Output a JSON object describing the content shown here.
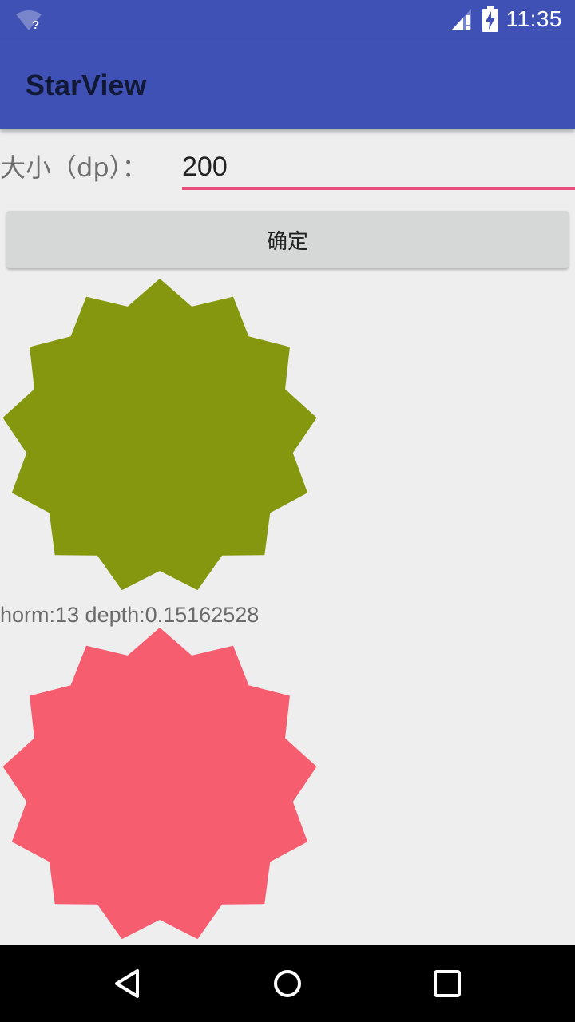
{
  "status_bar": {
    "time": "11:35",
    "wifi_badge": "?",
    "icons": [
      "wifi-icon",
      "signal-icon",
      "battery-charging-icon"
    ]
  },
  "app_bar": {
    "title": "StarView",
    "color": "#3f51b5"
  },
  "form": {
    "size_label": "大小（dp）：",
    "size_value": "200",
    "confirm_label": "确定"
  },
  "stars": [
    {
      "horns": 13,
      "depth": 0.15162528,
      "color": "#85970e"
    },
    {
      "horns": 13,
      "depth": 0.15162528,
      "color": "#f65e70"
    }
  ],
  "star_info_text": "horm:13 depth:0.15162528",
  "nav_bar": {
    "buttons": [
      "back-icon",
      "home-icon",
      "recents-icon"
    ]
  }
}
